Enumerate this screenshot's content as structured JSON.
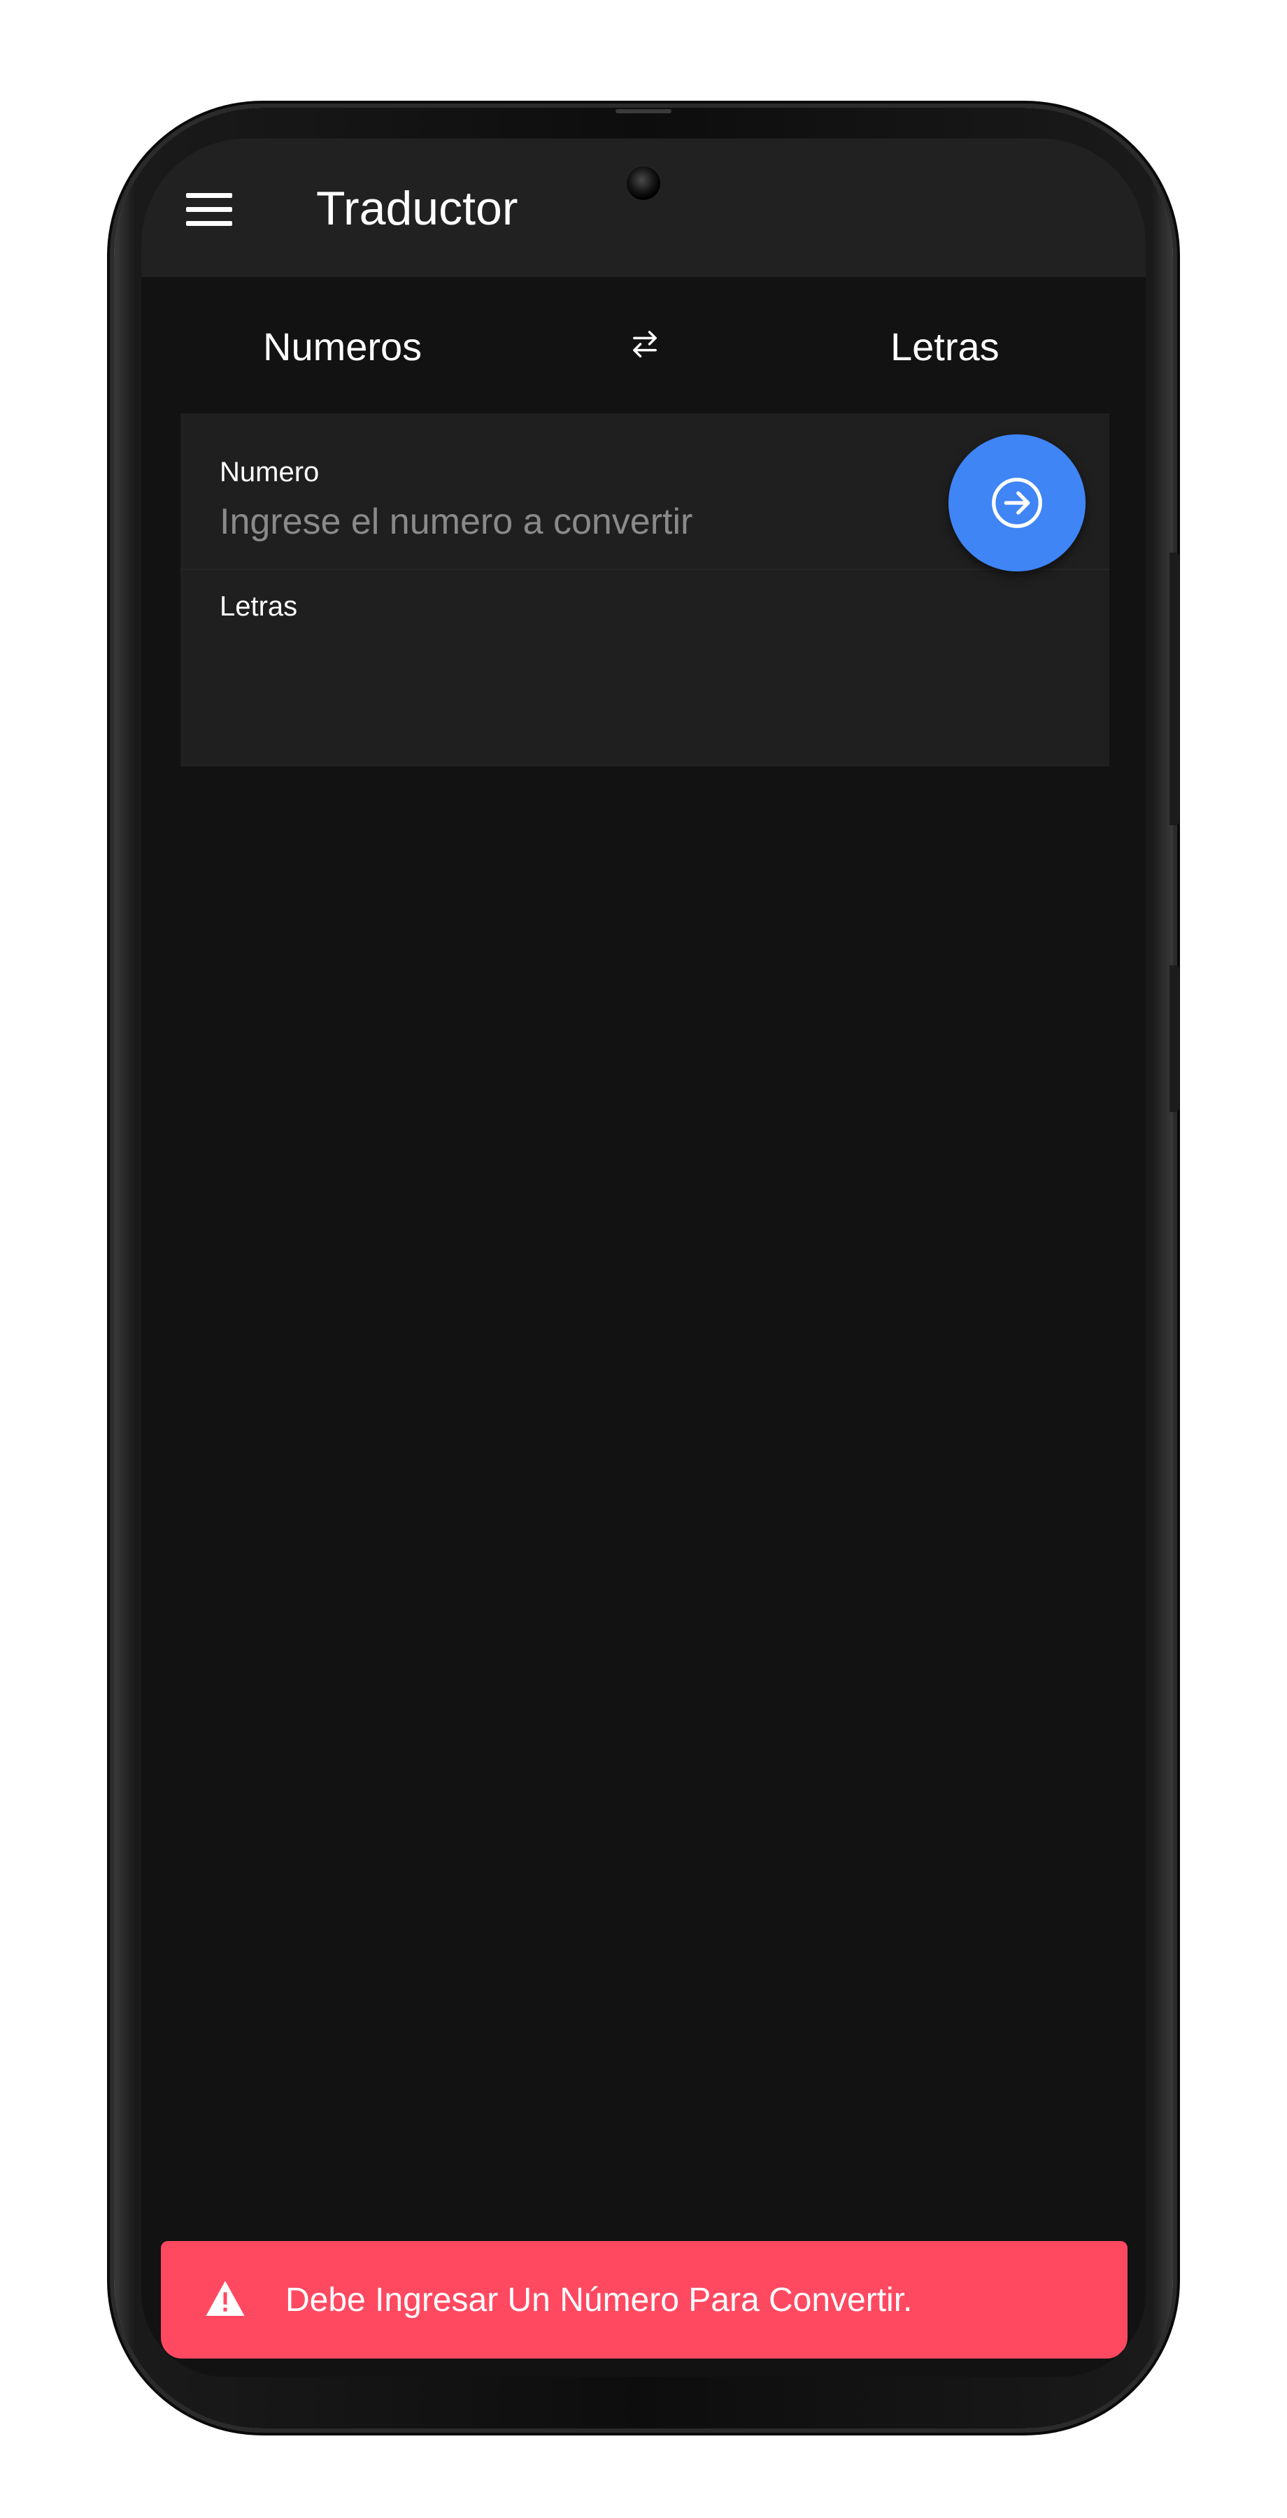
{
  "app": {
    "title": "Traductor"
  },
  "languages": {
    "from": "Numeros",
    "to": "Letras"
  },
  "fields": {
    "number": {
      "label": "Numero",
      "value": "",
      "placeholder": "Ingrese el numero a convertir"
    },
    "letters": {
      "label": "Letras",
      "value": ""
    }
  },
  "toast": {
    "message": "Debe Ingresar Un Número Para Convertir."
  },
  "icons": {
    "menu": "menu-icon",
    "swap": "swap-horizontal-icon",
    "convert": "arrow-forward-circle-icon",
    "warning": "warning-icon"
  },
  "colors": {
    "background": "#121212",
    "appbar": "#212121",
    "card": "#1f1f1f",
    "accent": "#3f85f5",
    "danger": "#ff4961"
  }
}
